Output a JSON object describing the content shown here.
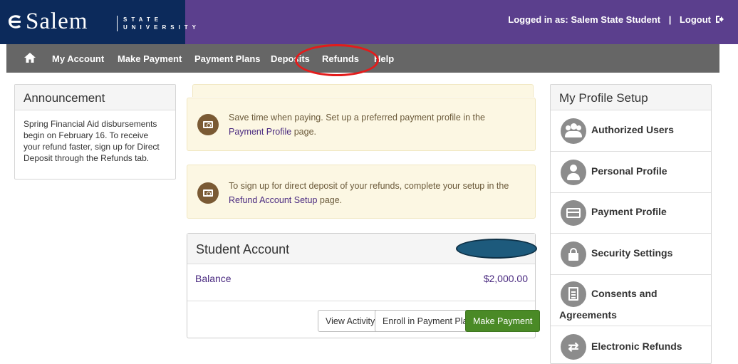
{
  "header": {
    "logo_main": "Salem",
    "logo_sub_line1": "STATE",
    "logo_sub_line2": "UNIVERSITY",
    "login_text": "Logged in as: Salem State Student",
    "separator": "|",
    "logout_label": "Logout",
    "logout_icon": "sign-out-icon"
  },
  "nav": {
    "home_icon": "home-icon",
    "items": [
      "My Account",
      "Make Payment",
      "Payment Plans",
      "Deposits",
      "Refunds",
      "Help"
    ]
  },
  "announcement": {
    "title": "Announcement",
    "body": "Spring Financial Aid disbursements begin on February 16. To receive your refund faster, sign up for Direct Deposit through the Refunds tab."
  },
  "alerts": [
    {
      "icon": "money-icon",
      "text_before": "Save time when paying. Set up a preferred payment profile in the ",
      "link": "Payment Profile",
      "text_after": " page."
    },
    {
      "icon": "money-icon",
      "text_before": "To sign up for direct deposit of your refunds, complete your setup in the ",
      "link": "Refund Account Setup",
      "text_after": " page."
    }
  ],
  "student_account": {
    "title": "Student Account",
    "balance_label": "Balance",
    "balance_value": "$2,000.00",
    "buttons": {
      "view_activity": "View Activity",
      "enroll_plan": "Enroll in Payment Plan",
      "make_payment": "Make Payment"
    }
  },
  "profile_setup": {
    "title": "My Profile Setup",
    "items": [
      {
        "label": "Authorized Users",
        "icon": "users-icon"
      },
      {
        "label": "Personal Profile",
        "icon": "user-icon"
      },
      {
        "label": "Payment Profile",
        "icon": "credit-card-icon"
      },
      {
        "label": "Security Settings",
        "icon": "lock-icon"
      },
      {
        "label_line1": "Consents and",
        "label_line2": "Agreements",
        "icon": "document-icon"
      },
      {
        "label": "Electronic Refunds",
        "icon": "refresh-icon"
      }
    ]
  },
  "colors": {
    "header_purple": "#5b3f8d",
    "logo_navy": "#0c2a5b",
    "nav_gray": "#666666",
    "alert_bg": "#fcf7e3",
    "link_purple": "#4a2a80",
    "primary_green": "#4a8a26",
    "annotation_red": "#e31b1b",
    "redaction_blue": "#1d5a7c"
  }
}
